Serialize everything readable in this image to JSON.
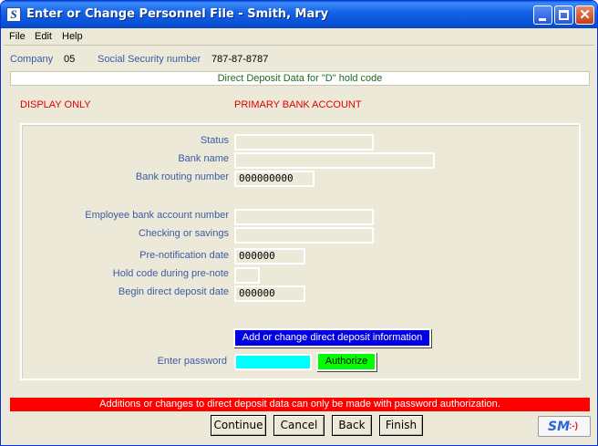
{
  "window": {
    "app_icon_letter": "S",
    "title": "Enter or Change Personnel File - Smith, Mary"
  },
  "menu": [
    {
      "label": "File"
    },
    {
      "label": "Edit"
    },
    {
      "label": "Help"
    }
  ],
  "header": {
    "company_label": "Company",
    "company_value": "05",
    "ssn_label": "Social Security number",
    "ssn_value": "787-87-8787"
  },
  "section_title": "Direct Deposit Data for \"D\" hold code",
  "mode_label": "DISPLAY ONLY",
  "account_label": "PRIMARY BANK ACCOUNT",
  "fields": {
    "status": {
      "label": "Status",
      "value": ""
    },
    "bank_name": {
      "label": "Bank name",
      "value": ""
    },
    "routing": {
      "label": "Bank routing number",
      "value": "000000000"
    },
    "account_number": {
      "label": "Employee bank account number",
      "value": ""
    },
    "checking_savings": {
      "label": "Checking or savings",
      "value": ""
    },
    "prenote_date": {
      "label": "Pre-notification date",
      "value": "000000"
    },
    "hold_code": {
      "label": "Hold code during pre-note",
      "value": ""
    },
    "begin_date": {
      "label": "Begin direct deposit date",
      "value": "000000"
    }
  },
  "add_change_button": "Add or change direct deposit information",
  "password": {
    "label": "Enter password",
    "value": ""
  },
  "authorize_button": "Authorize",
  "warning": "Additions or changes to direct deposit data can only be made with password authorization.",
  "buttons": {
    "continue": "Continue",
    "cancel": "Cancel",
    "back": "Back",
    "finish": "Finish"
  },
  "logo": {
    "text": "SM",
    "face": ":-)"
  },
  "colors": {
    "title_bar": "#0a5fe0",
    "label_blue": "#3a5ba8",
    "warning_red": "#ff0000",
    "add_button": "#0000e6",
    "password_field": "#00ffff",
    "authorize_button": "#00ff00"
  }
}
